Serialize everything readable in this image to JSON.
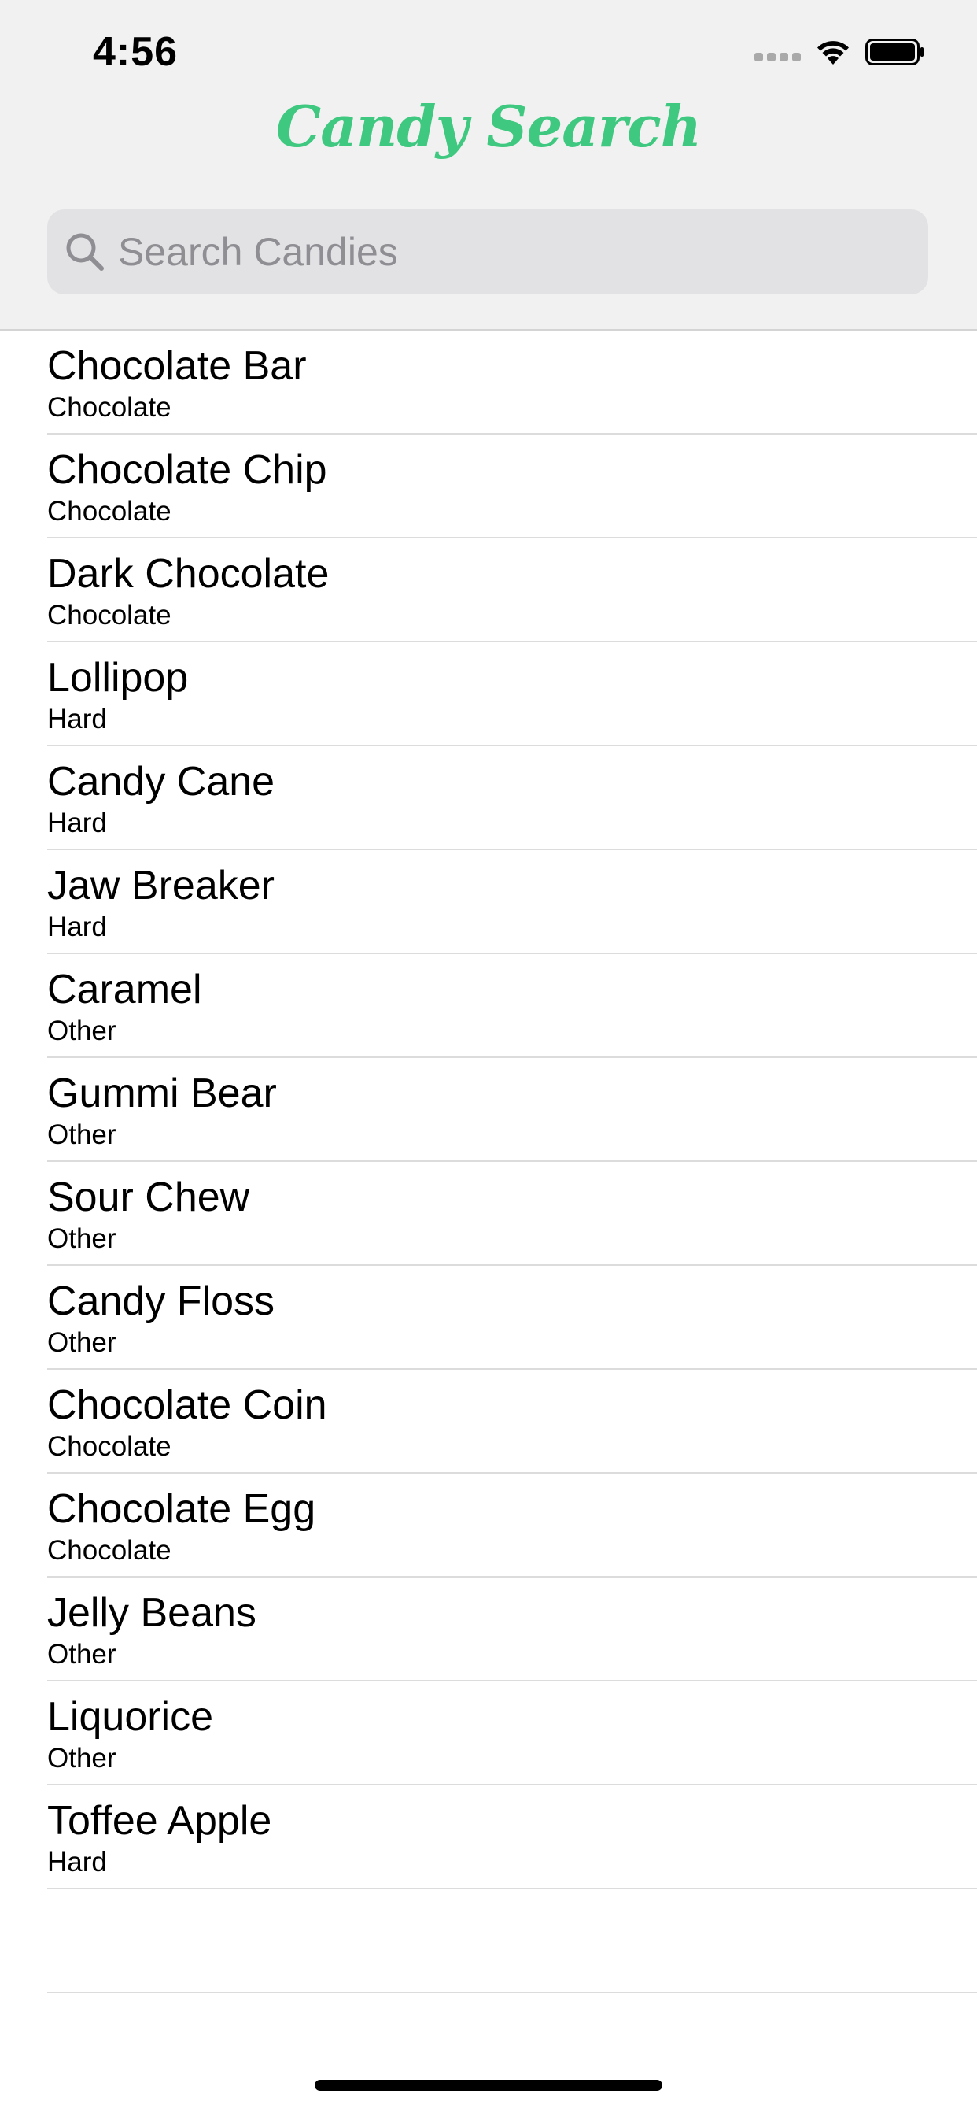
{
  "status_bar": {
    "time": "4:56",
    "icons": [
      "cellular-signal-icon",
      "wifi-icon",
      "battery-icon"
    ]
  },
  "nav": {
    "title": "Candy Search",
    "title_color": "#3fc87f"
  },
  "search": {
    "placeholder": "Search Candies",
    "value": ""
  },
  "candies": [
    {
      "name": "Chocolate Bar",
      "category": "Chocolate"
    },
    {
      "name": "Chocolate Chip",
      "category": "Chocolate"
    },
    {
      "name": "Dark Chocolate",
      "category": "Chocolate"
    },
    {
      "name": "Lollipop",
      "category": "Hard"
    },
    {
      "name": "Candy Cane",
      "category": "Hard"
    },
    {
      "name": "Jaw Breaker",
      "category": "Hard"
    },
    {
      "name": "Caramel",
      "category": "Other"
    },
    {
      "name": "Gummi Bear",
      "category": "Other"
    },
    {
      "name": "Sour Chew",
      "category": "Other"
    },
    {
      "name": "Candy Floss",
      "category": "Other"
    },
    {
      "name": "Chocolate Coin",
      "category": "Chocolate"
    },
    {
      "name": "Chocolate Egg",
      "category": "Chocolate"
    },
    {
      "name": "Jelly Beans",
      "category": "Other"
    },
    {
      "name": "Liquorice",
      "category": "Other"
    },
    {
      "name": "Toffee Apple",
      "category": "Hard"
    }
  ]
}
